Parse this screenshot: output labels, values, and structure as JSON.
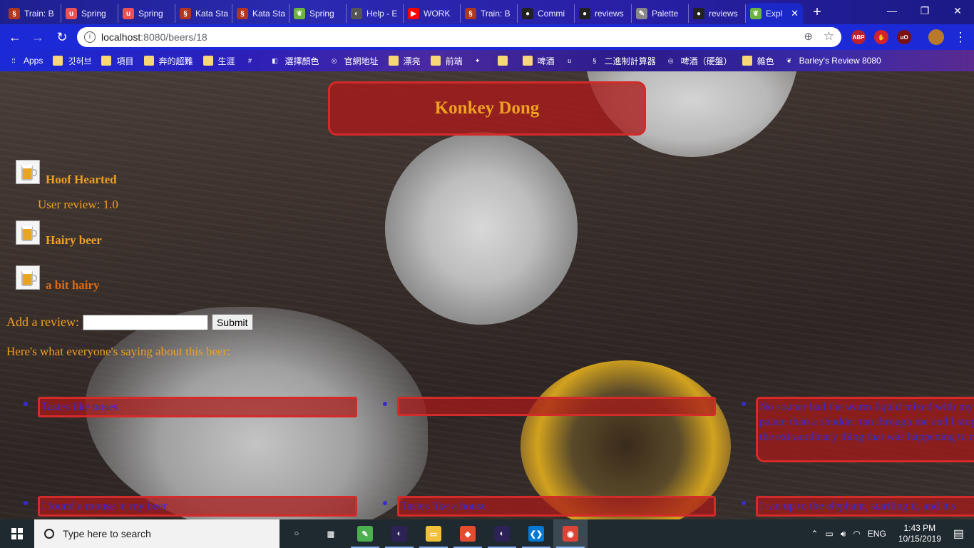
{
  "browser": {
    "tabs": [
      {
        "label": "Train: B",
        "icon": "codewars-icon",
        "color": "#b1361e"
      },
      {
        "label": "Spring",
        "icon": "udemy-icon",
        "color": "#ec5252"
      },
      {
        "label": "Spring",
        "icon": "udemy-icon",
        "color": "#ec5252"
      },
      {
        "label": "Kata Sta",
        "icon": "codewars-icon",
        "color": "#b1361e"
      },
      {
        "label": "Kata Sta",
        "icon": "codewars-icon",
        "color": "#b1361e"
      },
      {
        "label": "Spring",
        "icon": "spring-leaf-icon",
        "color": "#6db33f"
      },
      {
        "label": "Help - E",
        "icon": "eclipse-icon",
        "color": "#555555"
      },
      {
        "label": "WORK",
        "icon": "youtube-icon",
        "color": "#ff0000"
      },
      {
        "label": "Train: B",
        "icon": "codewars-icon",
        "color": "#b1361e"
      },
      {
        "label": "Commi",
        "icon": "github-icon",
        "color": "#222222"
      },
      {
        "label": "reviews",
        "icon": "github-icon",
        "color": "#222222"
      },
      {
        "label": "Palette",
        "icon": "palette-icon",
        "color": "#888888"
      },
      {
        "label": "reviews",
        "icon": "github-icon",
        "color": "#222222"
      }
    ],
    "active_tab": {
      "label": "Expl",
      "icon": "spring-leaf-icon",
      "color": "#6db33f"
    },
    "url_host": "localhost",
    "url_rest": ":8080/beers/18",
    "bookmarks": [
      {
        "label": "Apps",
        "icon": "apps-grid-icon"
      },
      {
        "label": "깃허브",
        "icon": "folder-icon"
      },
      {
        "label": "項目",
        "icon": "folder-icon"
      },
      {
        "label": "奔的超難",
        "icon": "folder-icon"
      },
      {
        "label": "生涯",
        "icon": "folder-icon"
      },
      {
        "label": "",
        "icon": "slack-icon"
      },
      {
        "label": "選擇顏色",
        "icon": "color-picker-icon"
      },
      {
        "label": "官網地址",
        "icon": "globe-icon"
      },
      {
        "label": "漂亮",
        "icon": "folder-icon"
      },
      {
        "label": "前端",
        "icon": "folder-icon"
      },
      {
        "label": "",
        "icon": "compass-icon"
      },
      {
        "label": "",
        "icon": "folder-icon"
      },
      {
        "label": "啤酒",
        "icon": "folder-icon"
      },
      {
        "label": "",
        "icon": "udemy-icon"
      },
      {
        "label": "二進制計算器",
        "icon": "codewars-icon"
      },
      {
        "label": "啤酒（硬盤）",
        "icon": "globe-icon"
      },
      {
        "label": "雜色",
        "icon": "folder-icon"
      },
      {
        "label": "Barley's Review 8080",
        "icon": "spring-leaf-icon"
      }
    ]
  },
  "page": {
    "title": "Konkey Dong",
    "tags": [
      {
        "name": "Hoof Hearted"
      },
      {
        "name": "Hairy beer"
      },
      {
        "name": "a bit hairy"
      }
    ],
    "user_review": "User review: 1.0",
    "add_review_label": "Add a review:",
    "review_input_value": "",
    "submit_label": "Submit",
    "saying_text": "Here's what everyone's saying about this beer:",
    "reviews": [
      "Tastes like noses",
      "",
      "No sooner had the warm liquid mixed with my crumbs touched my palate than a shudder ran through me and I stopped, intent upon the extraordinary thing that was happening to me.",
      "I found a mouse in my beer",
      "Tastes like a house",
      "I ran up to the elephant, startling it, and it s"
    ],
    "colors": {
      "title_text": "#f0a020",
      "box_fill": "#aa1919",
      "box_border": "#d32a2a",
      "review_text": "#3a2ad0"
    }
  },
  "taskbar": {
    "search_placeholder": "Type here to search",
    "apps": [
      "cortana-icon",
      "task-view-icon",
      "notepad-icon",
      "eclipse-icon",
      "file-explorer-icon",
      "git-icon",
      "eclipse-icon",
      "vscode-icon",
      "chrome-icon"
    ],
    "language": "ENG",
    "time": "1:43 PM",
    "date": "10/15/2019"
  }
}
